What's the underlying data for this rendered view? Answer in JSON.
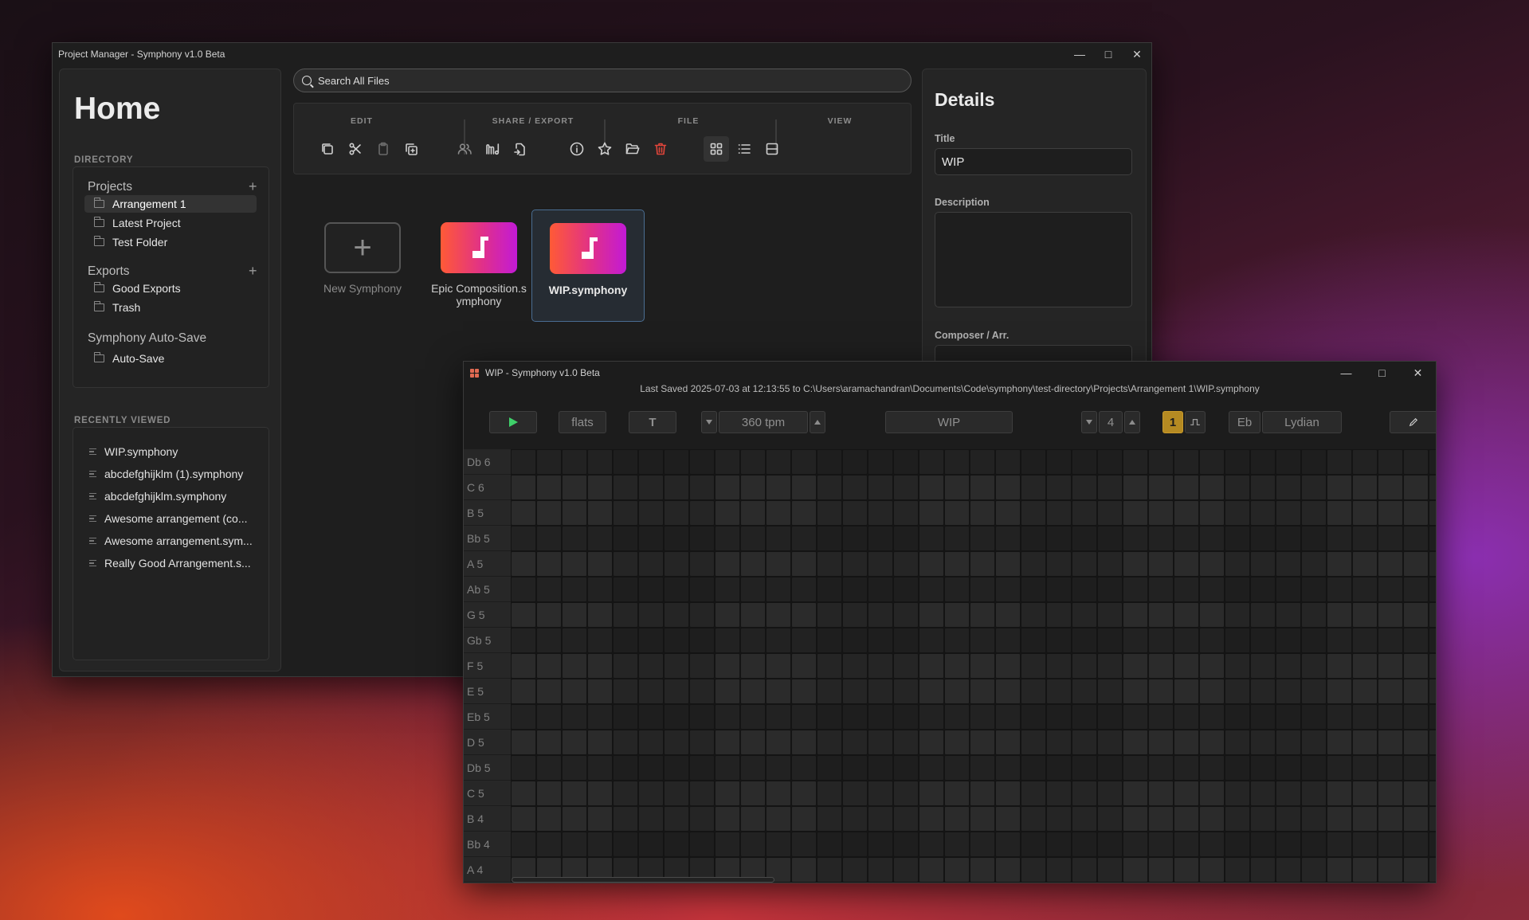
{
  "project_manager": {
    "window_title": "Project Manager - Symphony v1.0 Beta",
    "sidebar": {
      "home_title": "Home",
      "directory_label": "DIRECTORY",
      "projects_label": "Projects",
      "projects": [
        "Arrangement 1",
        "Latest Project",
        "Test Folder"
      ],
      "exports_label": "Exports",
      "exports": [
        "Good Exports",
        "Trash"
      ],
      "autosave_label": "Symphony Auto-Save",
      "autosave": [
        "Auto-Save"
      ],
      "recent_label": "RECENTLY VIEWED",
      "recent": [
        "WIP.symphony",
        "abcdefghijklm (1).symphony",
        "abcdefghijklm.symphony",
        "Awesome arrangement (co...",
        "Awesome arrangement.sym...",
        "Really Good Arrangement.s..."
      ]
    },
    "search": {
      "placeholder": "Search All Files"
    },
    "toolbar": {
      "edit_label": "EDIT",
      "share_label": "SHARE / EXPORT",
      "file_label": "FILE",
      "view_label": "VIEW"
    },
    "files": {
      "new": "New Symphony",
      "epic": "Epic Composition.symphony",
      "wip": "WIP.symphony"
    },
    "details": {
      "heading": "Details",
      "title_label": "Title",
      "title_value": "WIP",
      "description_label": "Description",
      "description_value": "",
      "composer_label": "Composer / Arr."
    }
  },
  "symphony": {
    "window_title": "WIP - Symphony v1.0 Beta",
    "last_saved": "Last Saved 2025-07-03 at 12:13:55 to C:\\Users\\aramachandran\\Documents\\Code\\symphony\\test-directory\\Projects\\Arrangement 1\\WIP.symphony",
    "accidentals": "flats",
    "text_tool": "T",
    "tempo": "360 tpm",
    "song_name": "WIP",
    "beats": "4",
    "subdivision": "1",
    "key": "Eb",
    "mode": "Lydian",
    "note_labels": [
      "Db 6",
      "C 6",
      "B 5",
      "Bb 5",
      "A 5",
      "Ab 5",
      "G 5",
      "Gb 5",
      "F 5",
      "E 5",
      "Eb 5",
      "D 5",
      "Db 5",
      "C 5",
      "B 4",
      "Bb 4",
      "A 4"
    ],
    "grid_columns": 37
  },
  "colors": {
    "accent_blue": "#4a6d92",
    "play_green": "#3fd06a",
    "delete_red": "#e0453a",
    "gold": "#b58a22"
  }
}
